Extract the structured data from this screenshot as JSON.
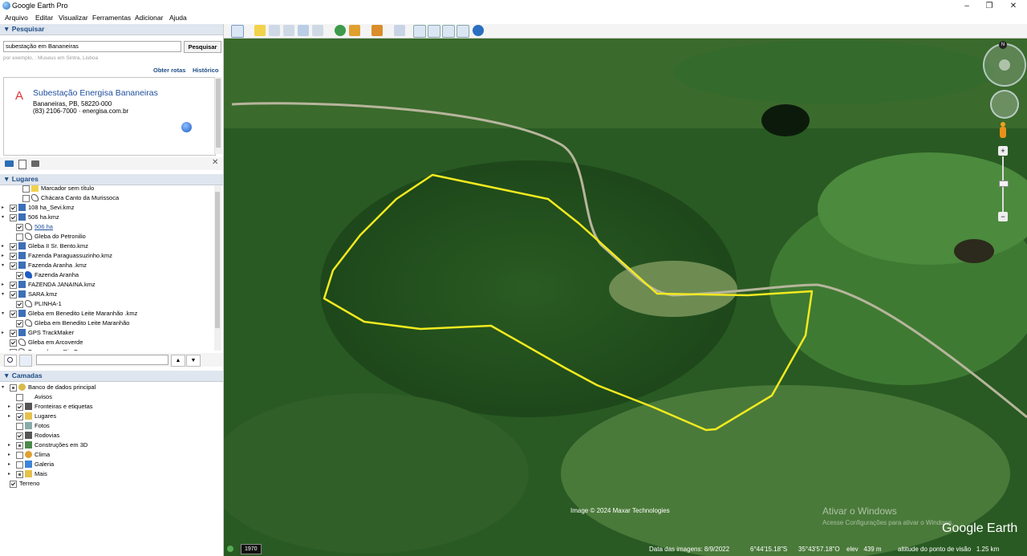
{
  "app": {
    "title": "Google Earth Pro"
  },
  "window_controls": {
    "minimize": "–",
    "restore": "❐",
    "close": "✕"
  },
  "menu": [
    "Arquivo",
    "Editar",
    "Visualizar",
    "Ferramentas",
    "Adicionar",
    "Ajuda"
  ],
  "search": {
    "header": "Pesquisar",
    "value": "subestação em Bananeiras",
    "button": "Pesquisar",
    "hint": "por exemplo, : Museus em Sintra, Lisboa",
    "route_link": "Obter rotas",
    "history_link": "Histórico",
    "result": {
      "marker": "A",
      "name": "Subestação Energisa Bananeiras",
      "address": "Bananeiras, PB, 58220-000",
      "phone_site": "(83) 2106-7000 · energisa.com.br"
    }
  },
  "places": {
    "header": "Lugares",
    "items": [
      {
        "label": "Marcador sem título",
        "indent": 2,
        "checked": false,
        "expand": "",
        "icon": "pin-icon",
        "link": false
      },
      {
        "label": "Chácara Canto da Murissoca",
        "indent": 2,
        "checked": false,
        "expand": "",
        "icon": "polygon-icon",
        "link": false
      },
      {
        "label": "108 ha_Sevi.kmz",
        "indent": 0,
        "checked": true,
        "expand": "▸",
        "icon": "kmz-icon",
        "link": false
      },
      {
        "label": "506 ha.kmz",
        "indent": 0,
        "checked": true,
        "expand": "▾",
        "icon": "kmz-icon",
        "link": false
      },
      {
        "label": "506 ha",
        "indent": 1,
        "checked": true,
        "expand": "",
        "icon": "polygon-icon",
        "link": true
      },
      {
        "label": "Gleba do Petronilio",
        "indent": 1,
        "checked": false,
        "expand": "",
        "icon": "polygon-icon",
        "link": false
      },
      {
        "label": "Gleba II Sr. Bento.kmz",
        "indent": 0,
        "checked": true,
        "expand": "▸",
        "icon": "kmz-icon",
        "link": false
      },
      {
        "label": "Fazenda Paraguassuzinho.kmz",
        "indent": 0,
        "checked": true,
        "expand": "▸",
        "icon": "kmz-icon",
        "link": false
      },
      {
        "label": "Fazenda Aranha .kmz",
        "indent": 0,
        "checked": true,
        "expand": "▾",
        "icon": "kmz-icon",
        "link": false
      },
      {
        "label": "Fazenda Aranha",
        "indent": 1,
        "checked": true,
        "expand": "",
        "icon": "filled-polygon-icon",
        "link": false
      },
      {
        "label": "FAZENDA JANAINA.kmz",
        "indent": 0,
        "checked": true,
        "expand": "▸",
        "icon": "kmz-icon",
        "link": false
      },
      {
        "label": "SARA.kmz",
        "indent": 0,
        "checked": true,
        "expand": "▾",
        "icon": "kmz-icon",
        "link": false
      },
      {
        "label": "PLINHA-1",
        "indent": 1,
        "checked": true,
        "expand": "",
        "icon": "polygon-icon",
        "link": false
      },
      {
        "label": "Gleba em Benedito Leite Maranhão .kmz",
        "indent": 0,
        "checked": true,
        "expand": "▾",
        "icon": "kmz-icon",
        "link": false
      },
      {
        "label": "Gleba em Benedito Leite Maranhão",
        "indent": 1,
        "checked": true,
        "expand": "",
        "icon": "polygon-icon",
        "link": false
      },
      {
        "label": "GPS TrackMaker",
        "indent": 0,
        "checked": true,
        "expand": "▸",
        "icon": "kmz-icon",
        "link": false
      },
      {
        "label": "Gleba em Arcoverde",
        "indent": 0,
        "checked": true,
        "expand": "",
        "icon": "polygon-icon",
        "link": false
      },
      {
        "label": "Fazenda em Rio Formoso",
        "indent": 0,
        "checked": true,
        "expand": "",
        "icon": "polygon-icon",
        "link": false
      }
    ]
  },
  "layers": {
    "header": "Camadas",
    "items": [
      {
        "label": "Banco de dados principal",
        "indent": 0,
        "checked": "partial",
        "expand": "▾",
        "icon": "globe-db-icon"
      },
      {
        "label": "Avisos",
        "indent": 1,
        "checked": false,
        "expand": "",
        "icon": "mail-icon"
      },
      {
        "label": "Fronteiras e etiquetas",
        "indent": 1,
        "checked": true,
        "expand": "▸",
        "icon": "flag-icon"
      },
      {
        "label": "Lugares",
        "indent": 1,
        "checked": true,
        "expand": "▸",
        "icon": "places-icon"
      },
      {
        "label": "Fotos",
        "indent": 1,
        "checked": false,
        "expand": "",
        "icon": "photo-icon"
      },
      {
        "label": "Rodovias",
        "indent": 1,
        "checked": true,
        "expand": "",
        "icon": "road-icon"
      },
      {
        "label": "Construções em 3D",
        "indent": 1,
        "checked": "partial",
        "expand": "▸",
        "icon": "buildings-icon"
      },
      {
        "label": "Clima",
        "indent": 1,
        "checked": false,
        "expand": "▸",
        "icon": "sun-icon"
      },
      {
        "label": "Galeria",
        "indent": 1,
        "checked": false,
        "expand": "▸",
        "icon": "gallery-icon"
      },
      {
        "label": "Mais",
        "indent": 1,
        "checked": "partial",
        "expand": "▸",
        "icon": "folder-icon"
      },
      {
        "label": "Terreno",
        "indent": 0,
        "checked": true,
        "expand": "",
        "icon": ""
      }
    ]
  },
  "map": {
    "copyright": "Image © 2024 Maxar Technologies",
    "watermark": "Ativar o Windows",
    "watermark_sub": "Acesse Configurações para ativar o Windows.",
    "brand": "Google Earth",
    "compass_north": "N",
    "status": {
      "historical_year": "1970",
      "image_date": "Data das imagens: 8/9/2022",
      "lat": "6°44'15.18\"S",
      "lon": "35°43'57.18\"O",
      "elev": "elev   439 m",
      "eye_alt": "altitude do ponto de visão   1.25 km"
    },
    "colors": {
      "boundary": "#f2ea1f",
      "forest": "#1f4d1c"
    }
  }
}
